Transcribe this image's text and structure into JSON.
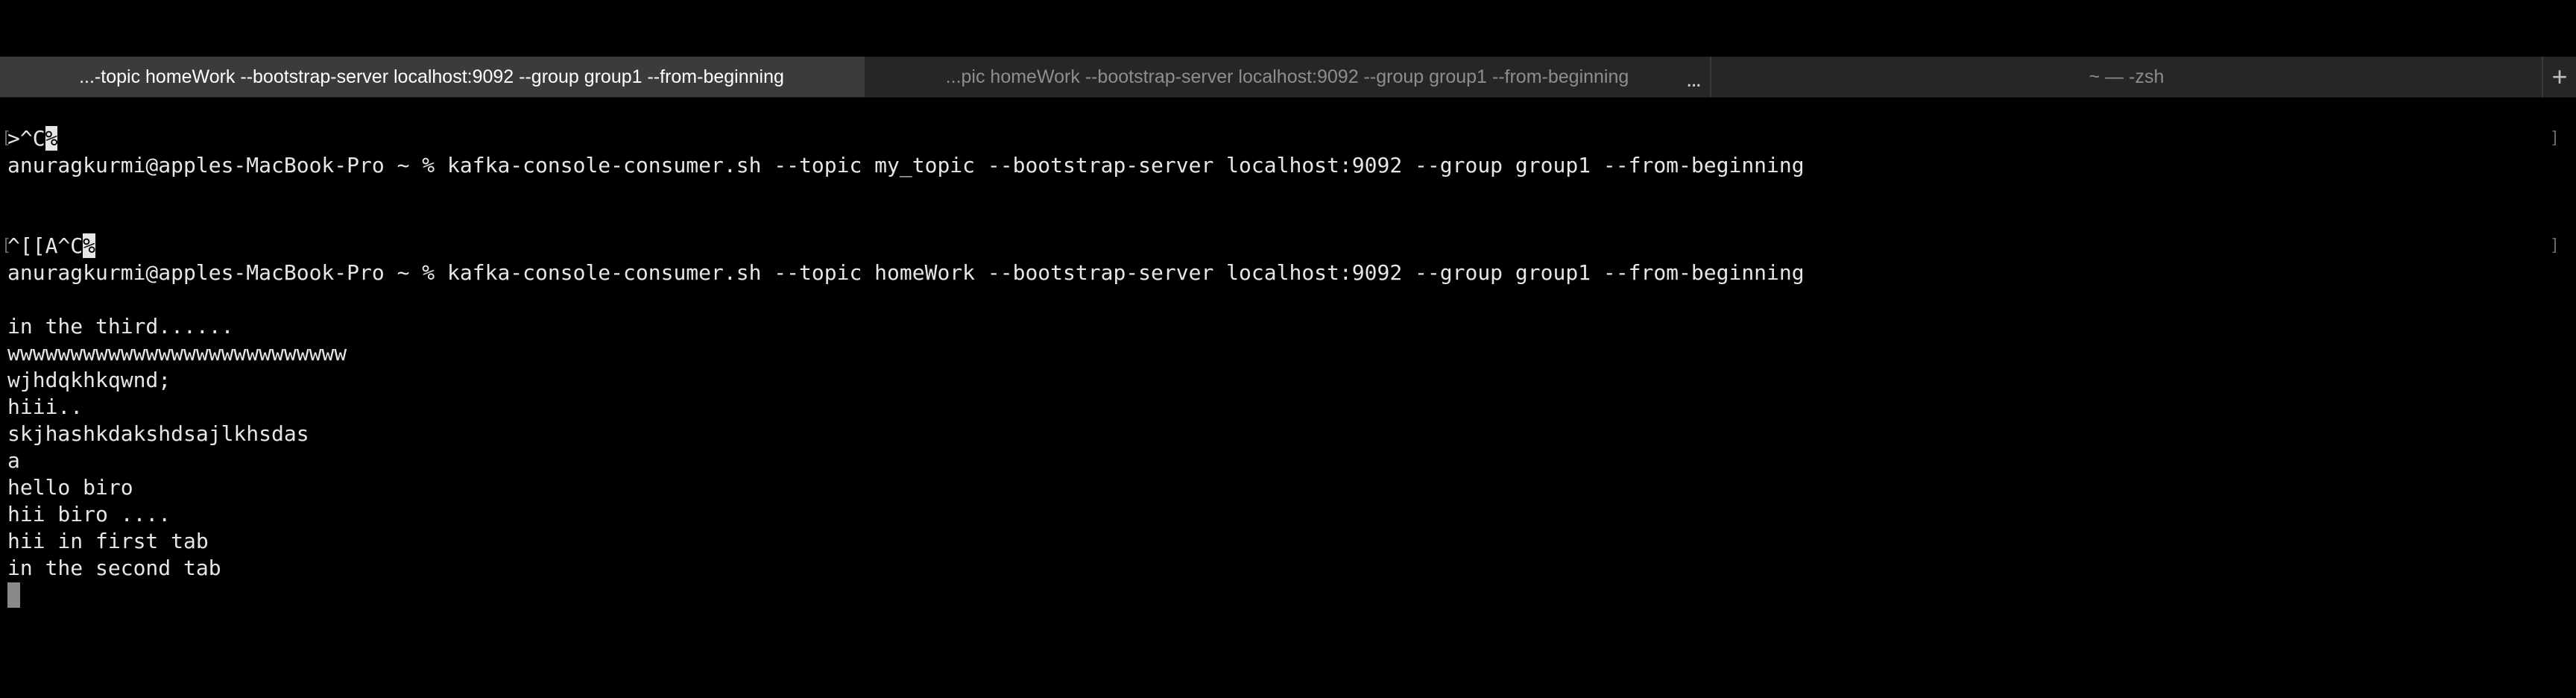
{
  "tabs": [
    {
      "title": "...-topic homeWork --bootstrap-server localhost:9092 --group group1 --from-beginning",
      "active": true
    },
    {
      "title": "...pic homeWork --bootstrap-server localhost:9092 --group group1 --from-beginning",
      "active": false
    },
    {
      "title": "~ — -zsh",
      "active": false
    }
  ],
  "tab_overflow": "...",
  "tab_add": "+",
  "terminal": {
    "block1": {
      "interrupt_prefix": ">^C",
      "interrupt_inverse": "%",
      "prompt": "anuragkurmi@apples-MacBook-Pro ~ % kafka-console-consumer.sh --topic my_topic --bootstrap-server localhost:9092 --group group1 --from-beginning"
    },
    "block2": {
      "interrupt_prefix": "^[[A^C",
      "interrupt_inverse": "%",
      "prompt": "anuragkurmi@apples-MacBook-Pro ~ % kafka-console-consumer.sh --topic homeWork --bootstrap-server localhost:9092 --group group1 --from-beginning"
    },
    "messages": [
      "in the third......",
      "wwwwwwwwwwwwwwwwwwwwwwwwwww",
      "wjhdqkhkqwnd;",
      "hiii..",
      "skjhashkdakshdsajlkhsdas",
      "a",
      "hello biro",
      "hii biro ....",
      "hii in first tab",
      "in the second tab"
    ]
  },
  "colors": {
    "background": "#000000",
    "tabbar": "#262626",
    "active_tab": "#3b3b3b",
    "text": "#e6e6e6",
    "cursor": "#8a8a8a"
  }
}
